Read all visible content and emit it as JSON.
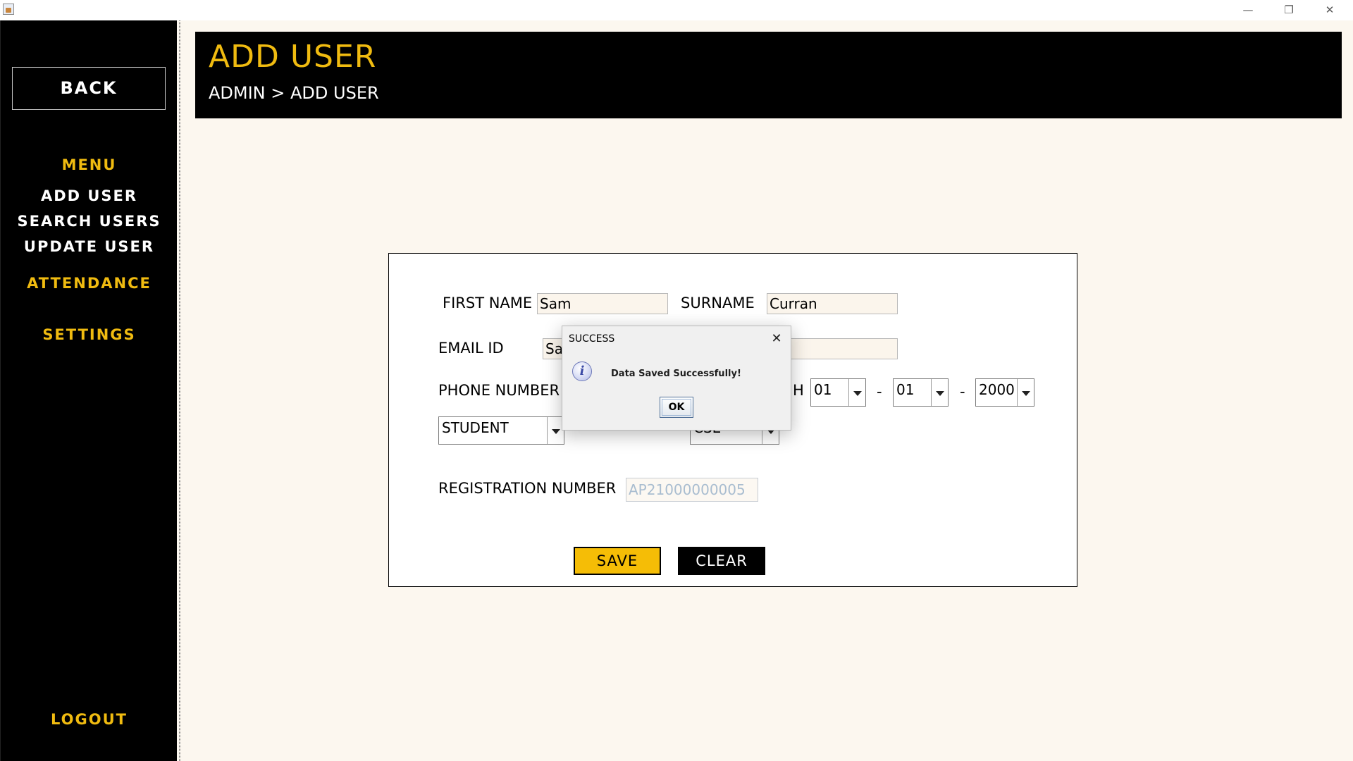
{
  "window": {
    "minimize_glyph": "—",
    "maximize_glyph": "❐",
    "close_glyph": "✕"
  },
  "sidebar": {
    "back_label": "BACK",
    "menu_heading": "MENU",
    "items": [
      {
        "label": "ADD USER"
      },
      {
        "label": "SEARCH USERS"
      },
      {
        "label": "UPDATE USER"
      }
    ],
    "attendance_label": "ATTENDANCE",
    "settings_label": "SETTINGS",
    "logout_label": "LOGOUT"
  },
  "header": {
    "title": "ADD USER",
    "breadcrumb": "ADMIN > ADD USER"
  },
  "form": {
    "first_name_label": "FIRST NAME",
    "first_name_value": "Sam",
    "surname_label": "SURNAME",
    "surname_value": "Curran",
    "email_label": "EMAIL ID",
    "email_value": "Sa",
    "phone_label": "PHONE NUMBER",
    "dob_label_fragment": "H",
    "dob_day": "01",
    "dob_month": "01",
    "dob_year": "2000",
    "dash": "-",
    "role_value": "STUDENT",
    "department_value_partial": "CSE",
    "registration_label": "REGISTRATION NUMBER",
    "registration_value": "AP21000000005",
    "save_label": "SAVE",
    "clear_label": "CLEAR"
  },
  "dialog": {
    "title": "SUCCESS",
    "close_glyph": "✕",
    "info_glyph": "i",
    "message": "Data Saved Successfully!",
    "ok_label": "OK"
  },
  "colors": {
    "accent_yellow": "#f0bb10",
    "save_button": "#f5bd06",
    "sidebar_bg": "#000000",
    "page_bg": "#fcf7ef"
  }
}
